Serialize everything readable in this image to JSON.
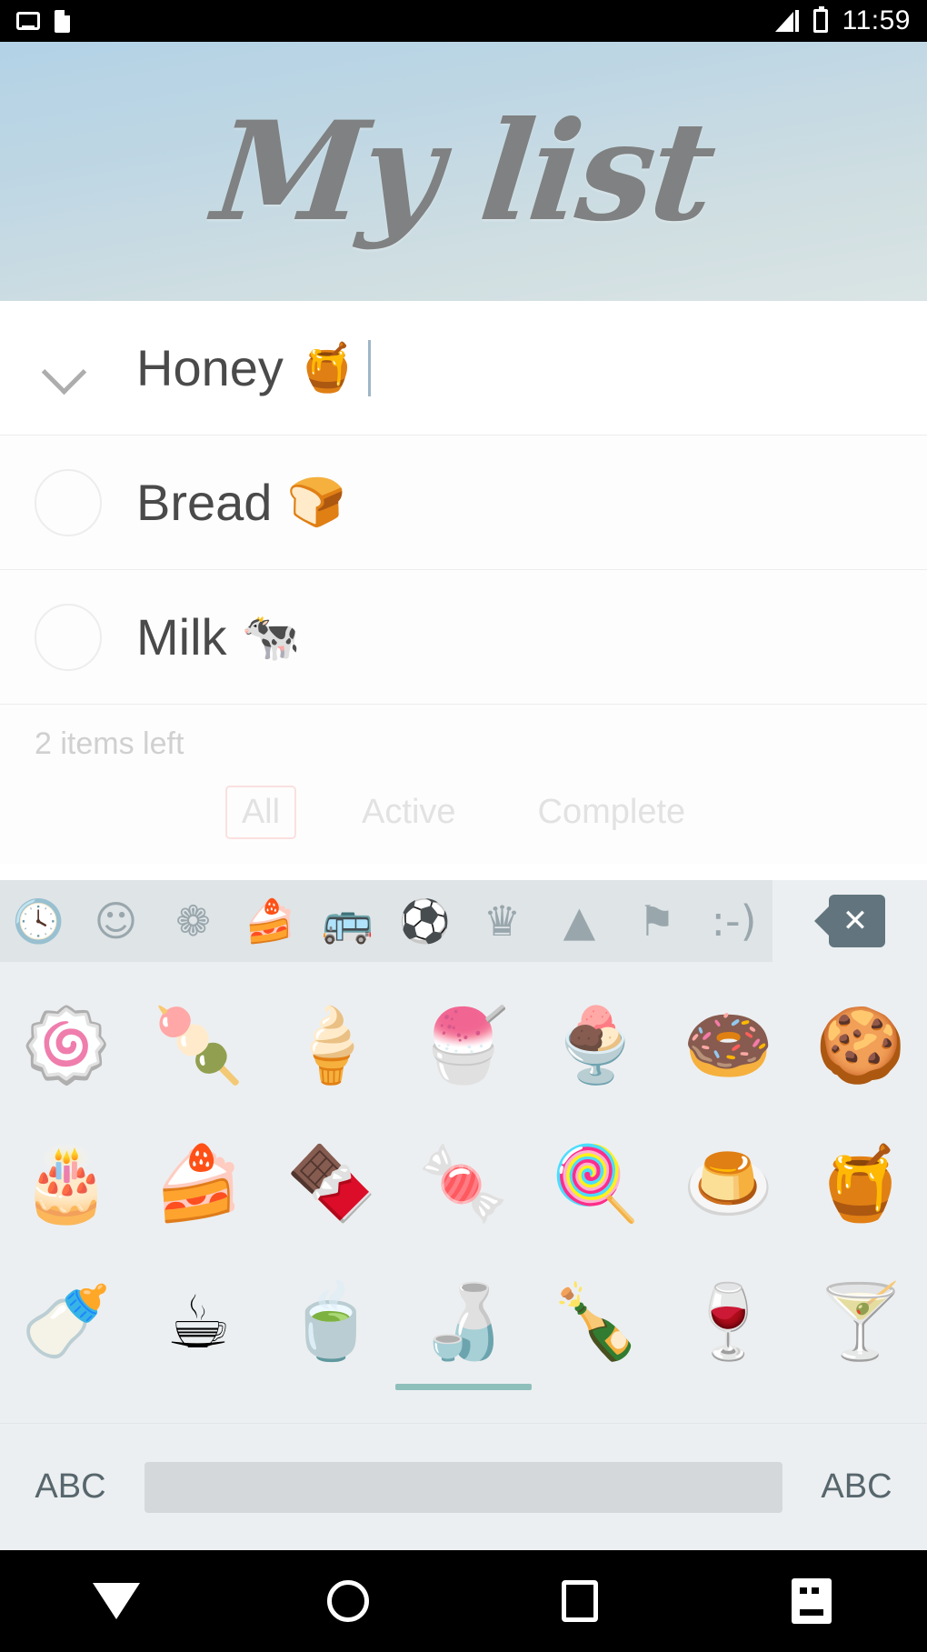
{
  "statusbar": {
    "time": "11:59",
    "icons": [
      "cast-icon",
      "sim-card-icon",
      "signal-icon",
      "battery-icon"
    ]
  },
  "header": {
    "title": "My list"
  },
  "list": {
    "rows": [
      {
        "label": "Honey",
        "emoji": "🍯",
        "toggle": "chevron-down-icon",
        "editing": true,
        "completed": false
      },
      {
        "label": "Bread",
        "emoji": "🍞",
        "toggle": "checkbox-circle",
        "editing": false,
        "completed": false
      },
      {
        "label": "Milk",
        "emoji": "🐄",
        "toggle": "checkbox-circle",
        "editing": false,
        "completed": false
      }
    ]
  },
  "footer": {
    "items_left": "2 items left",
    "filters": [
      {
        "label": "All",
        "selected": true
      },
      {
        "label": "Active",
        "selected": false
      },
      {
        "label": "Complete",
        "selected": false
      }
    ],
    "selected_border_color": "#fbe0e0"
  },
  "keyboard": {
    "categories": [
      {
        "name": "recent-category",
        "glyph": "🕓",
        "active": false
      },
      {
        "name": "smileys-category",
        "glyph": "☺",
        "active": false
      },
      {
        "name": "nature-category",
        "glyph": "❁",
        "active": false
      },
      {
        "name": "food-category",
        "glyph": "🍰",
        "active": true
      },
      {
        "name": "travel-category",
        "glyph": "🚌",
        "active": false
      },
      {
        "name": "activity-category",
        "glyph": "⚽",
        "active": false
      },
      {
        "name": "objects-category",
        "glyph": "♛",
        "active": false
      },
      {
        "name": "symbols-category",
        "glyph": "▲",
        "active": false
      },
      {
        "name": "flags-category",
        "glyph": "⚑",
        "active": false
      },
      {
        "name": "emoticons-category",
        "glyph": ":-)",
        "active": false
      }
    ],
    "backspace_label": "✕",
    "emoji_rows": [
      [
        "🍥",
        "🍡",
        "🍦",
        "🍧",
        "🍨",
        "🍩",
        "🍪"
      ],
      [
        "🎂",
        "🍰",
        "🍫",
        "🍬",
        "🍭",
        "🍮",
        "🍯"
      ],
      [
        "🍼",
        "☕",
        "🍵",
        "🍶",
        "🍾",
        "🍷",
        "🍸"
      ]
    ],
    "bottom": {
      "left_label": "ABC",
      "right_label": "ABC",
      "space_key": "space-bar",
      "page_indicator_color": "#8fbfbb"
    }
  },
  "navbar": {
    "buttons": [
      {
        "name": "nav-back-button",
        "icon": "triangle-down-icon"
      },
      {
        "name": "nav-home-button",
        "icon": "circle-icon"
      },
      {
        "name": "nav-recents-button",
        "icon": "square-icon"
      },
      {
        "name": "nav-keyboard-switch-button",
        "icon": "keyboard-icon"
      }
    ]
  }
}
